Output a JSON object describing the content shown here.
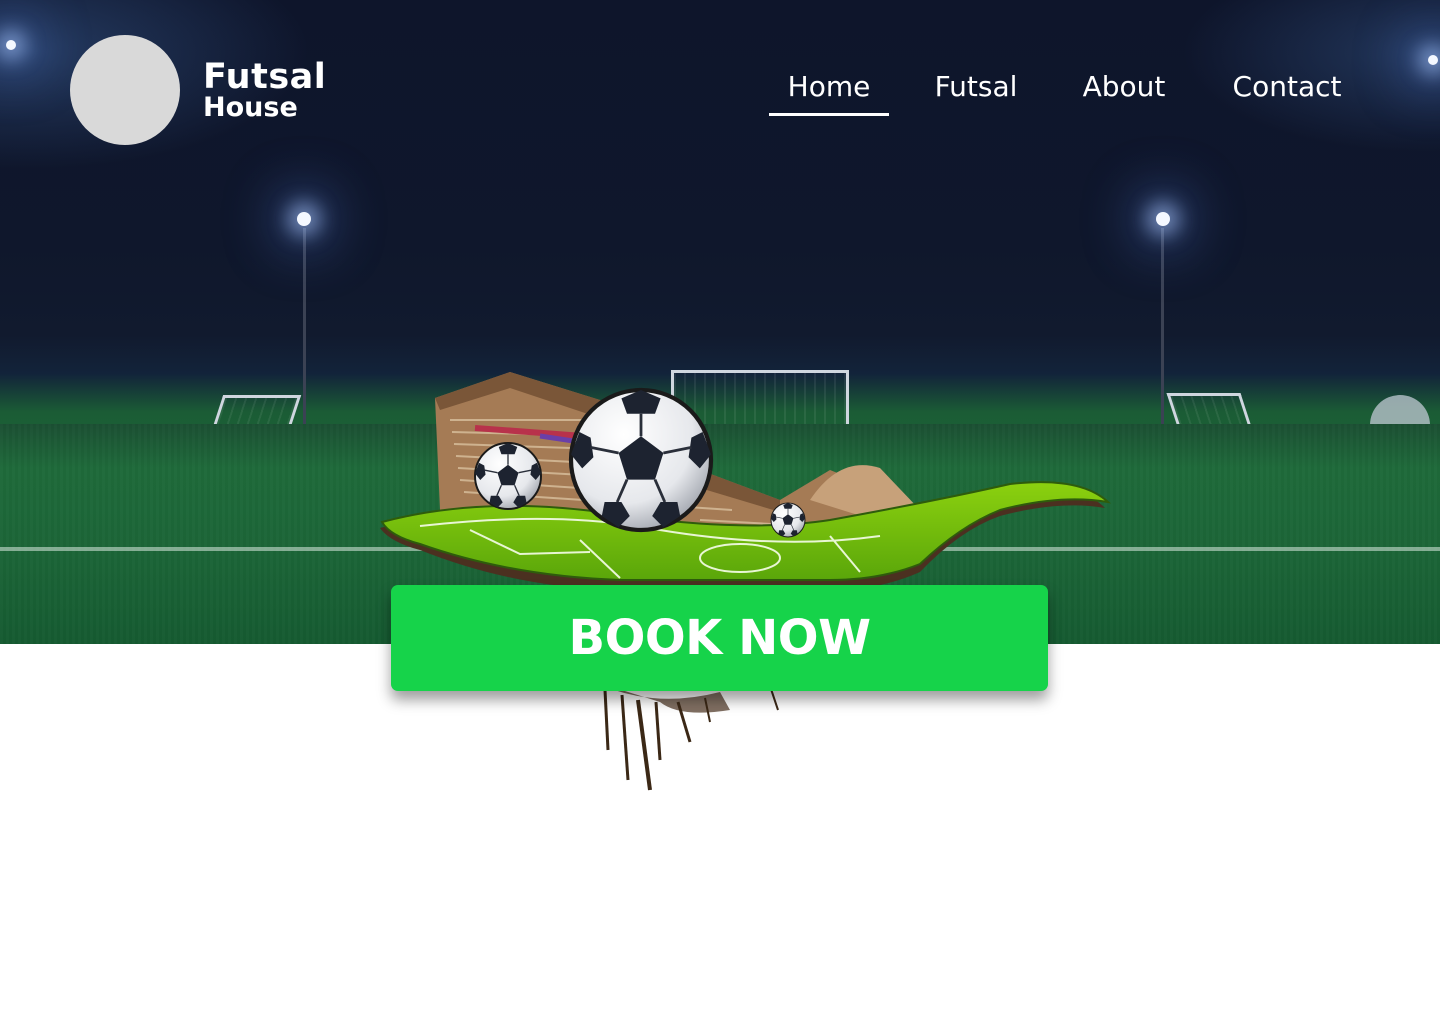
{
  "brand": {
    "name_line1": "Futsal",
    "name_line2": "House"
  },
  "nav": {
    "items": [
      {
        "label": "Home",
        "active": true
      },
      {
        "label": "Futsal",
        "active": false
      },
      {
        "label": "About",
        "active": false
      },
      {
        "label": "Contact",
        "active": false
      }
    ]
  },
  "hero": {
    "cta_label": "BOOK NOW"
  },
  "colors": {
    "navy": "#0e152b",
    "cta_green": "#16d34a",
    "logo_gray": "#d9d9d9",
    "pitch_green": "#1e6a3a"
  },
  "icons": [
    "soccer-ball-icon"
  ]
}
